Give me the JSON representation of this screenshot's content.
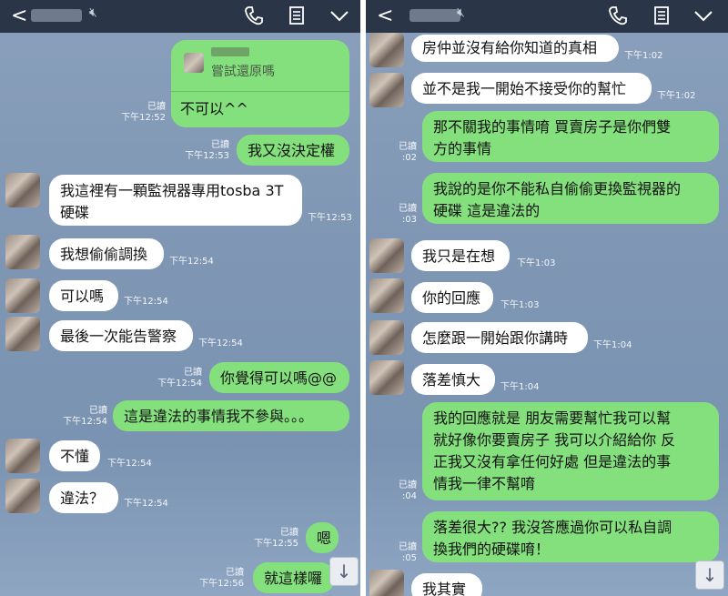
{
  "left": {
    "header": {
      "back_glyph": "<",
      "mute_icon": "mute-icon"
    },
    "quoted": {
      "text": "嘗試還原嗎"
    },
    "messages": [
      {
        "side": "out",
        "text": "不可以^^",
        "read": "已讀",
        "time": "下午12:52"
      },
      {
        "side": "out",
        "text": "我又沒決定權",
        "read": "已讀",
        "time": "下午12:53"
      },
      {
        "side": "in",
        "text": "我這裡有一顆監視器專用tosba 3T\n硬碟",
        "time": "下午12:53"
      },
      {
        "side": "in",
        "text": "我想偷偷調換",
        "time": "下午12:54"
      },
      {
        "side": "in",
        "text": "可以嗎",
        "time": "下午12:54"
      },
      {
        "side": "in",
        "text": "最後一次能告警察",
        "time": "下午12:54"
      },
      {
        "side": "out",
        "text": "你覺得可以嗎@@",
        "read": "已讀",
        "time": "下午12:54"
      },
      {
        "side": "out",
        "text": "這是違法的事情我不參與。。。",
        "read": "已讀",
        "time": "下午12:54"
      },
      {
        "side": "in",
        "text": "不懂",
        "time": "下午12:54"
      },
      {
        "side": "in",
        "text": "違法？",
        "time": "下午12:54"
      },
      {
        "side": "out",
        "text": "嗯",
        "read": "已讀",
        "time": "下午12:55"
      },
      {
        "side": "out",
        "text": "就這樣囉",
        "read": "已讀",
        "time": "下午12:56"
      }
    ],
    "scroll_glyph": "↓"
  },
  "right": {
    "header": {
      "back_glyph": "<",
      "mute_icon": "mute-icon"
    },
    "messages": [
      {
        "side": "in",
        "text": "房仲並沒有給你知道的真相",
        "time": "下午1:02"
      },
      {
        "side": "in",
        "text": "並不是我一開始不接受你的幫忙",
        "time": "下午1:02"
      },
      {
        "side": "out",
        "text": "那不關我的事情唷  買賣房子是你們雙\n方的事情",
        "read": "已讀",
        "time": ":02"
      },
      {
        "side": "out",
        "text": "我說的是你不能私自偷偷更換監視器的\n硬碟  這是違法的",
        "read": "已讀",
        "time": ":03"
      },
      {
        "side": "in",
        "text": "我只是在想",
        "time": "下午1:03"
      },
      {
        "side": "in",
        "text": "你的回應",
        "time": "下午1:03"
      },
      {
        "side": "in",
        "text": "怎麼跟一開始跟你講時",
        "time": "下午1:04"
      },
      {
        "side": "in",
        "text": "落差慎大",
        "time": "下午1:04"
      },
      {
        "side": "out",
        "text": "我的回應就是  朋友需要幫忙我可以幫\n就好像你要賣房子  我可以介紹給你  反\n正我又沒有拿任何好處  但是違法的事\n情我一律不幫唷",
        "read": "已讀",
        "time": ":04"
      },
      {
        "side": "out",
        "text": "落差很大??  我沒答應過你可以私自調\n換我們的硬碟唷！",
        "read": "已讀",
        "time": ":05"
      },
      {
        "side": "in",
        "text": "我其實",
        "time": ""
      }
    ],
    "scroll_glyph": "↓"
  }
}
